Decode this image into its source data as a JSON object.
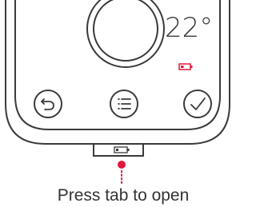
{
  "device": {
    "temperature_display": "22°",
    "battery_indicator": "low",
    "buttons": [
      {
        "name": "back-button",
        "icon": "back-arrow-icon"
      },
      {
        "name": "menu-button",
        "icon": "list-icon"
      },
      {
        "name": "confirm-button",
        "icon": "checkmark-icon"
      }
    ],
    "tab_battery_indicator": "low"
  },
  "caption": "Press tab to open",
  "colors": {
    "outline": "#3a3a3a",
    "accent": "#e0183c"
  }
}
